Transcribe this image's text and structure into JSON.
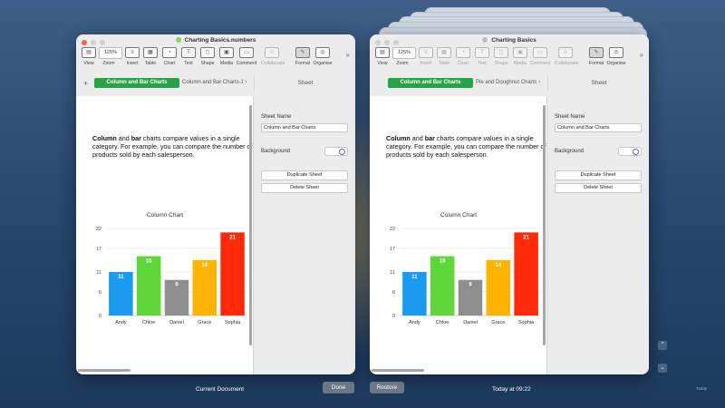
{
  "colors": {
    "green_tab": "#27a348",
    "bars": [
      "#1a9bf0",
      "#5fd63a",
      "#8f8f8f",
      "#ffb400",
      "#ff2a0a"
    ]
  },
  "toolbar": {
    "zoom_value": "125%",
    "items": [
      {
        "label": "View",
        "icon": "view-icon"
      },
      {
        "label": "Zoom",
        "icon": "zoom-icon"
      },
      {
        "label": "Insert",
        "icon": "insert-icon"
      },
      {
        "label": "Table",
        "icon": "table-icon"
      },
      {
        "label": "Chart",
        "icon": "chart-icon"
      },
      {
        "label": "Text",
        "icon": "text-icon"
      },
      {
        "label": "Shape",
        "icon": "shape-icon"
      },
      {
        "label": "Media",
        "icon": "media-icon"
      },
      {
        "label": "Comment",
        "icon": "comment-icon"
      },
      {
        "label": "Collaborate",
        "icon": "collaborate-icon"
      },
      {
        "label": "Format",
        "icon": "format-icon"
      },
      {
        "label": "Organise",
        "icon": "organise-icon"
      }
    ]
  },
  "left_window": {
    "title": "Charting Basics.numbers",
    "tab_active": "Column and Bar Charts",
    "tab_other": "Column and Bar Charts-1",
    "sheet_header": "Sheet"
  },
  "right_window": {
    "title": "Charting Basics",
    "tab_active": "Column and Bar Charts",
    "tab_other": "Pie and Doughnut Charts",
    "sheet_header": "Sheet"
  },
  "doc": {
    "bold1": "Column",
    "mid1": " and ",
    "bold2": "bar",
    "rest": " charts compare values in a single category. For example, you can compare the number of products sold by each salesperson."
  },
  "inspector": {
    "sheet_name_label": "Sheet Name",
    "sheet_name_value": "Column and Bar Charts",
    "background_label": "Background",
    "duplicate_label": "Duplicate Sheet",
    "delete_label": "Delete Sheet"
  },
  "chart_data": {
    "type": "bar",
    "title": "Column Chart",
    "categories": [
      "Andy",
      "Chloe",
      "Daniel",
      "Grace",
      "Sophia"
    ],
    "values": [
      11,
      15,
      9,
      14,
      21
    ],
    "yticks": [
      0,
      6,
      11,
      17,
      22
    ],
    "ylim": [
      0,
      22
    ],
    "grid": true
  },
  "footer": {
    "current_label": "Current Document",
    "done_label": "Done",
    "restore_label": "Restore",
    "time_label": "Today at 09:22",
    "today_small": "Today"
  },
  "side_buttons": {
    "up": "⌃",
    "down": "⌄"
  }
}
